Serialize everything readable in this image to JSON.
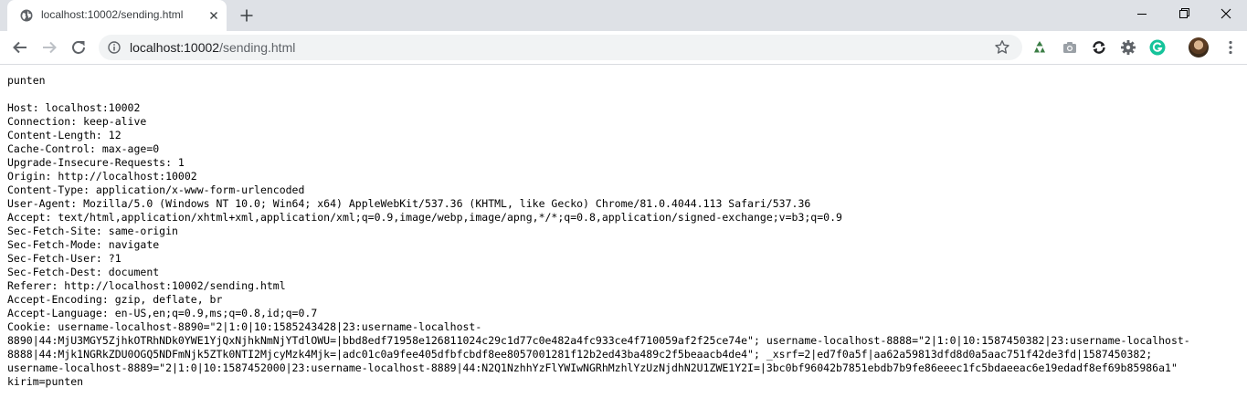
{
  "browser": {
    "tab_title": "localhost:10002/sending.html",
    "url_host": "localhost:10002",
    "url_path": "/sending.html"
  },
  "page": {
    "first_line": "punten",
    "headers": [
      "Host: localhost:10002",
      "Connection: keep-alive",
      "Content-Length: 12",
      "Cache-Control: max-age=0",
      "Upgrade-Insecure-Requests: 1",
      "Origin: http://localhost:10002",
      "Content-Type: application/x-www-form-urlencoded",
      "User-Agent: Mozilla/5.0 (Windows NT 10.0; Win64; x64) AppleWebKit/537.36 (KHTML, like Gecko) Chrome/81.0.4044.113 Safari/537.36",
      "Accept: text/html,application/xhtml+xml,application/xml;q=0.9,image/webp,image/apng,*/*;q=0.8,application/signed-exchange;v=b3;q=0.9",
      "Sec-Fetch-Site: same-origin",
      "Sec-Fetch-Mode: navigate",
      "Sec-Fetch-User: ?1",
      "Sec-Fetch-Dest: document",
      "Referer: http://localhost:10002/sending.html",
      "Accept-Encoding: gzip, deflate, br",
      "Accept-Language: en-US,en;q=0.9,ms;q=0.8,id;q=0.7",
      "Cookie: username-localhost-8890=\"2|1:0|10:1585243428|23:username-localhost-",
      "8890|44:MjU3MGY5ZjhkOTRhNDk0YWE1YjQxNjhkNmNjYTdlOWU=|bbd8edf71958e126811024c29c1d77c0e482a4fc933ce4f710059af2f25ce74e\"; username-localhost-8888=\"2|1:0|10:1587450382|23:username-localhost-",
      "8888|44:Mjk1NGRkZDU0OGQ5NDFmNjk5ZTk0NTI2MjcyMzk4Mjk=|adc01c0a9fee405dfbfcbdf8ee8057001281f12b2ed43ba489c2f5beaacb4de4\"; _xsrf=2|ed7f0a5f|aa62a59813dfd8d0a5aac751f42de3fd|1587450382;",
      "username-localhost-8889=\"2|1:0|10:1587452000|23:username-localhost-8889|44:N2Q1NzhhYzFlYWIwNGRhMzhlYzUzNjdhN2U1ZWE1Y2I=|3bc0bf96042b7851ebdb7b9fe86eeec1fc5bdaeeac6e19edadf8ef69b85986a1\"",
      "kirim=punten"
    ]
  },
  "colors": {
    "tabstrip_bg": "#dee1e6",
    "omnibox_bg": "#f1f3f4",
    "icon": "#5f6368",
    "grammarly": "#15c39a"
  },
  "icons": [
    "globe-icon",
    "close-icon",
    "plus-icon",
    "minimize-icon",
    "maximize-icon",
    "window-close-icon",
    "back-icon",
    "forward-icon",
    "reload-icon",
    "info-icon",
    "star-icon",
    "recycle-icon",
    "camera-icon",
    "sync-icon",
    "gear-icon",
    "grammarly-icon",
    "avatar",
    "kebab-menu-icon"
  ]
}
